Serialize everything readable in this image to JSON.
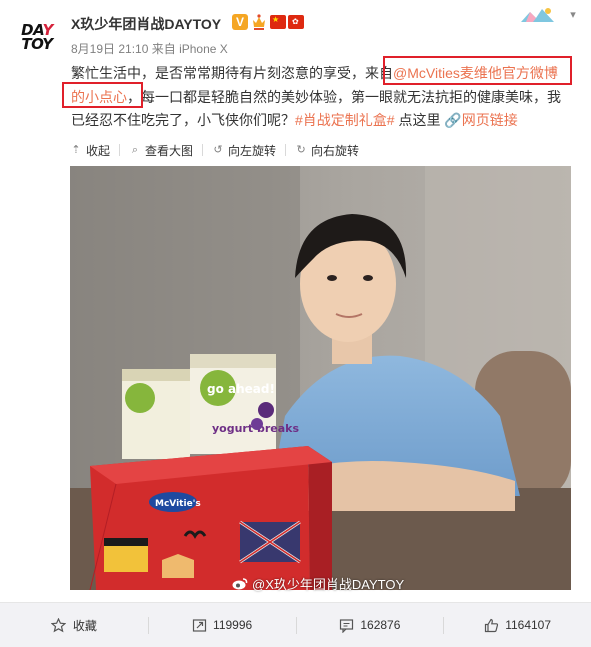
{
  "post": {
    "avatar": {
      "line1_a": "DA",
      "line1_b": "Y",
      "line2": "TOY"
    },
    "nickname": "X玖少年团肖战DAYTOY",
    "badge_v": "V",
    "time": "8月19日 21:10",
    "source": "来自 iPhone X",
    "text": {
      "part1": "繁忙生活中，是否常常期待有片刻恣意的享受，来自",
      "mention": "@McVities麦维他官方微博",
      "newline_mention": "的小点心",
      "part2": "，每一口都是轻脆自然的美妙体验，第一眼就无法抗拒的健康美味，我已经忍不住吃完了，小飞侠你们呢？",
      "hashtag": "#肖战定制礼盒#",
      "part3": " 点这里 ",
      "weblink": "网页链接"
    },
    "image_actions": [
      {
        "icon": "collapse-icon",
        "label": "收起"
      },
      {
        "icon": "zoom-icon",
        "label": "查看大图"
      },
      {
        "icon": "rotate-left-icon",
        "label": "向左旋转"
      },
      {
        "icon": "rotate-right-icon",
        "label": "向右旋转"
      }
    ],
    "photo": {
      "watermark": "@X玖少年团肖战DAYTOY",
      "box_brand": "McVitie's",
      "go_ahead_text": "go ahead!",
      "yogurt_text": "yogurt breaks"
    }
  },
  "bottom_bar": [
    {
      "icon": "favorite-icon",
      "label": "收藏"
    },
    {
      "icon": "repost-icon",
      "label": "119996"
    },
    {
      "icon": "comment-icon",
      "label": "162876"
    },
    {
      "icon": "like-icon",
      "label": "1164107"
    }
  ],
  "colors": {
    "link": "#eb7350",
    "highlight_box": "#e0202a",
    "verified_badge": "#f5a623",
    "bottom_bar_bg": "#f2f2f5"
  }
}
